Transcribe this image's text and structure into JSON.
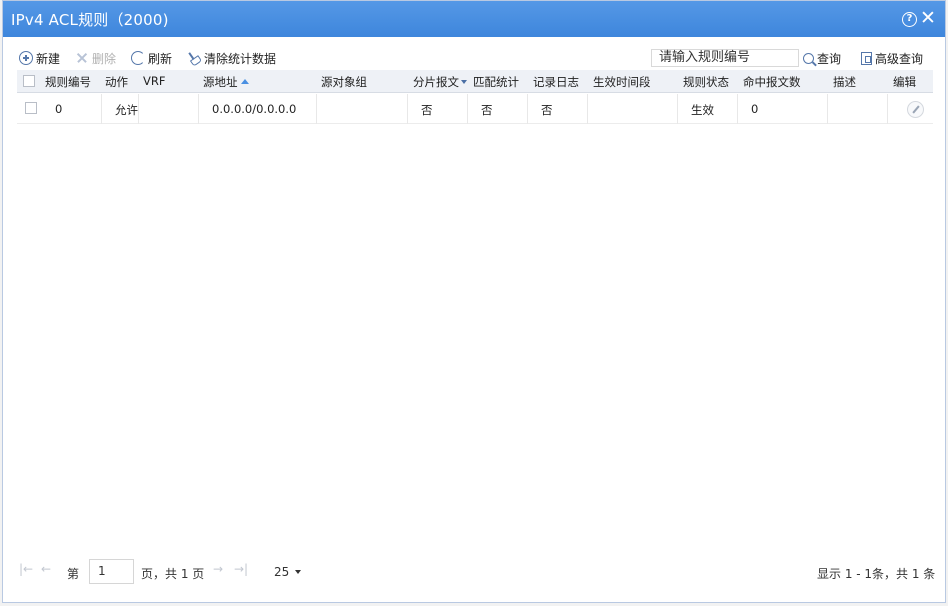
{
  "dialog": {
    "title": "IPv4 ACL规则（2000)",
    "help_glyph": "?",
    "close_glyph": "✕"
  },
  "toolbar": {
    "new_label": "新建",
    "delete_label": "删除",
    "refresh_label": "刷新",
    "clear_stats_label": "清除统计数据",
    "search_placeholder": "请输入规则编号",
    "query_label": "查询",
    "advanced_query_label": "高级查询"
  },
  "table": {
    "columns": [
      "规则编号",
      "动作",
      "VRF",
      "源地址",
      "源对象组",
      "分片报文",
      "匹配统计",
      "记录日志",
      "生效时间段",
      "规则状态",
      "命中报文数",
      "描述",
      "编辑"
    ],
    "rows": [
      {
        "rule_id": "0",
        "action": "允许",
        "vrf": "",
        "source_address": "0.0.0.0/0.0.0.0",
        "source_object_group": "",
        "fragment": "否",
        "match_stats": "否",
        "log": "否",
        "time_range": "",
        "status": "生效",
        "hit_packets": "0",
        "description": ""
      }
    ]
  },
  "pager": {
    "page_prefix": "第",
    "current_page": "1",
    "page_suffix": "页，共 1 页",
    "page_size": "25",
    "summary": "显示 1 - 1条，共 1 条"
  },
  "colors": {
    "titlebar": "#4a90e2",
    "header_bg": "#eef1f6",
    "icon": "#5577aa"
  }
}
